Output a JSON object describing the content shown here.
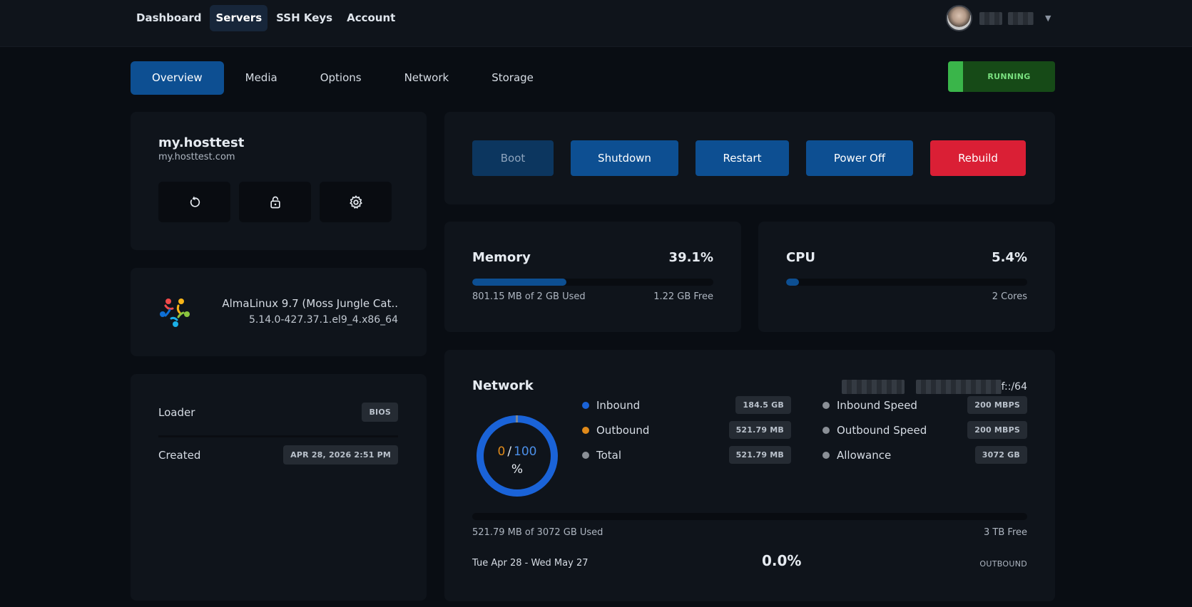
{
  "topnav": {
    "items": [
      "Dashboard",
      "Servers",
      "SSH Keys",
      "Account"
    ],
    "active": "Servers"
  },
  "user": {
    "avatar_icon": "user-avatar",
    "menu_icon": "caret-down-icon"
  },
  "tabs": [
    "Overview",
    "Media",
    "Options",
    "Network",
    "Storage"
  ],
  "status": {
    "label": "RUNNING",
    "color": "#3ab54a"
  },
  "server": {
    "name": "my.hosttest",
    "hostname": "my.hosttest.com",
    "icon_buttons": [
      "reload-icon",
      "unlock-icon",
      "gear-icon"
    ]
  },
  "os": {
    "logo_icon": "almalinux-logo",
    "name": "AlmaLinux 9.7 (Moss Jungle Cat..",
    "kernel": "5.14.0-427.37.1.el9_4.x86_64"
  },
  "meta": {
    "loader_label": "Loader",
    "loader_value": "BIOS",
    "created_label": "Created",
    "created_value": "APR 28, 2026 2:51 PM"
  },
  "actions": {
    "boot": "Boot",
    "shutdown": "Shutdown",
    "restart": "Restart",
    "power_off": "Power Off",
    "rebuild": "Rebuild"
  },
  "memory": {
    "title": "Memory",
    "percent": "39.1%",
    "fill_fraction": 0.391,
    "used": "801.15 MB of 2 GB Used",
    "free": "1.22 GB Free"
  },
  "cpu": {
    "title": "CPU",
    "percent": "5.4%",
    "fill_fraction": 0.054,
    "cores": "2 Cores"
  },
  "network": {
    "title": "Network",
    "ip_suffix": "f::/64",
    "donut": {
      "used": "0",
      "sep": "/",
      "total": "100",
      "unit": "%",
      "fill_fraction": 0.0
    },
    "inbound_label": "Inbound",
    "inbound_value": "184.5 GB",
    "outbound_label": "Outbound",
    "outbound_value": "521.79 MB",
    "total_label": "Total",
    "total_value": "521.79 MB",
    "inbound_speed_label": "Inbound Speed",
    "inbound_speed_value": "200 MBPS",
    "outbound_speed_label": "Outbound Speed",
    "outbound_speed_value": "200 MBPS",
    "allowance_label": "Allowance",
    "allowance_value": "3072 GB",
    "usage_fraction": 0.0,
    "used_text": "521.79 MB of 3072 GB Used",
    "free_text": "3 TB Free",
    "period": "Tue Apr 28 - Wed May 27",
    "percent": "0.0%",
    "direction": "OUTBOUND",
    "colors": {
      "inbound": "#1a63d8",
      "outbound": "#e08a1a",
      "total": "#8a8f96"
    }
  }
}
